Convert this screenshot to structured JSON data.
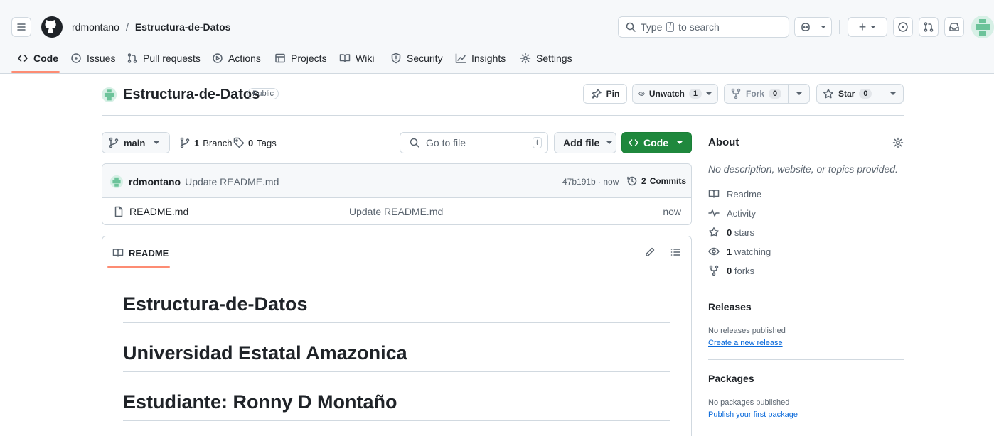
{
  "header": {
    "owner": "rdmontano",
    "separator": "/",
    "repo": "Estructura-de-Datos",
    "search_placeholder_pre": "Type",
    "search_key": "/",
    "search_placeholder_post": "to search",
    "plus_label": "+"
  },
  "tabs": [
    {
      "label": "Code",
      "icon": "code-icon"
    },
    {
      "label": "Issues",
      "icon": "issue-icon"
    },
    {
      "label": "Pull requests",
      "icon": "pull-request-icon"
    },
    {
      "label": "Actions",
      "icon": "play-icon"
    },
    {
      "label": "Projects",
      "icon": "table-icon"
    },
    {
      "label": "Wiki",
      "icon": "book-icon"
    },
    {
      "label": "Security",
      "icon": "shield-icon"
    },
    {
      "label": "Insights",
      "icon": "graph-icon"
    },
    {
      "label": "Settings",
      "icon": "gear-icon"
    }
  ],
  "repo_head": {
    "name": "Estructura-de-Datos",
    "visibility": "Public",
    "pin": "Pin",
    "unwatch": "Unwatch",
    "watch_count": "1",
    "fork": "Fork",
    "fork_count": "0",
    "star": "Star",
    "star_count": "0"
  },
  "toolbar": {
    "branch": "main",
    "branches_count": "1",
    "branches_label": "Branch",
    "tags_count": "0",
    "tags_label": "Tags",
    "goto_placeholder": "Go to file",
    "goto_key": "t",
    "add_file": "Add file",
    "code": "Code"
  },
  "commit": {
    "author": "rdmontano",
    "message": "Update README.md",
    "sha_time": "47b191b · now",
    "commits_count": "2",
    "commits_label": "Commits"
  },
  "files": [
    {
      "name": "README.md",
      "message": "Update README.md",
      "time": "now"
    }
  ],
  "readme": {
    "tab_label": "README",
    "headings": [
      "Estructura-de-Datos",
      "Universidad Estatal Amazonica",
      "Estudiante: Ronny D Montaño"
    ]
  },
  "about": {
    "title": "About",
    "description": "No description, website, or topics provided.",
    "readme": "Readme",
    "activity": "Activity",
    "stars_count": "0",
    "stars_label": "stars",
    "watching_count": "1",
    "watching_label": "watching",
    "forks_count": "0",
    "forks_label": "forks"
  },
  "releases": {
    "title": "Releases",
    "empty": "No releases published",
    "link": "Create a new release"
  },
  "packages": {
    "title": "Packages",
    "empty": "No packages published",
    "link": "Publish your first package"
  },
  "colors": {
    "accent": "#0969da",
    "primary_button": "#1f883d",
    "tab_underline": "#fd8c73",
    "avatar_green": "#6cc39a"
  }
}
